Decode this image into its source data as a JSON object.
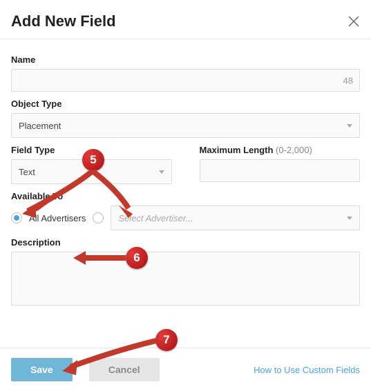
{
  "modal": {
    "title": "Add New Field"
  },
  "fields": {
    "name": {
      "label": "Name",
      "value": "",
      "counter": "48"
    },
    "object_type": {
      "label": "Object Type",
      "value": "Placement"
    },
    "field_type": {
      "label": "Field Type",
      "value": "Text"
    },
    "max_length": {
      "label": "Maximum Length",
      "hint": "(0-2,000)",
      "value": ""
    },
    "available_to": {
      "label": "Available To",
      "option_all": "All Advertisers",
      "advertiser_placeholder": "Select Advertiser..."
    },
    "description": {
      "label": "Description",
      "value": ""
    }
  },
  "footer": {
    "save": "Save",
    "cancel": "Cancel",
    "help_link": "How to Use Custom Fields"
  },
  "annotations": {
    "b5": "5",
    "b6": "6",
    "b7": "7"
  }
}
